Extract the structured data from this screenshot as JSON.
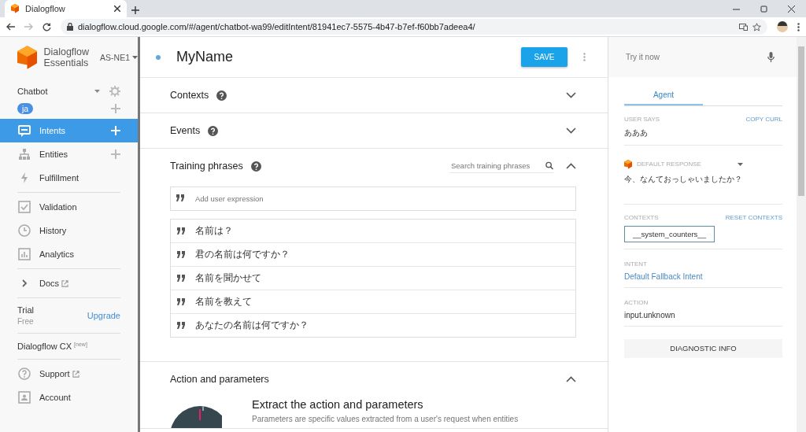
{
  "browser": {
    "tab_title": "Dialogflow",
    "url": "dialogflow.cloud.google.com/#/agent/chatbot-wa99/editIntent/81941ec7-5575-4b47-b7ef-f60bb7adeea4/"
  },
  "sidebar": {
    "brand_line1": "Dialogflow",
    "brand_line2": "Essentials",
    "region": "AS-NE1",
    "agent": "Chatbot",
    "language": "ja",
    "nav_groups": [
      [
        {
          "label": "Intents",
          "selected": true,
          "addable": true,
          "kind": "page"
        },
        {
          "label": "Entities",
          "selected": false,
          "addable": true,
          "kind": "page"
        },
        {
          "label": "Fulfillment",
          "selected": false,
          "addable": false,
          "kind": "page"
        }
      ],
      [
        {
          "label": "Validation",
          "selected": false,
          "addable": false,
          "kind": "page"
        },
        {
          "label": "History",
          "selected": false,
          "addable": false,
          "kind": "page"
        },
        {
          "label": "Analytics",
          "selected": false,
          "addable": false,
          "kind": "page"
        }
      ],
      [
        {
          "label": "Docs",
          "selected": false,
          "addable": false,
          "kind": "external"
        }
      ]
    ],
    "plan": {
      "name": "Trial",
      "tier": "Free",
      "upgrade": "Upgrade"
    },
    "cx": {
      "label": "Dialogflow CX",
      "badge": "[new]"
    },
    "bottom_nav": [
      {
        "label": "Support",
        "selected": false,
        "kind": "external"
      },
      {
        "label": "Account",
        "selected": false,
        "kind": "page"
      }
    ]
  },
  "intent": {
    "title": "MyName",
    "save": "SAVE"
  },
  "sections": [
    {
      "title": "Contexts",
      "help": true,
      "expanded": false
    },
    {
      "title": "Events",
      "help": true,
      "expanded": false
    },
    {
      "title": "Training phrases",
      "help": true,
      "expanded": true,
      "search_placeholder": "Search training phrases",
      "add_placeholder": "Add user expression",
      "phrases": [
        "名前は？",
        "君の名前は何ですか？",
        "名前を聞かせて",
        "名前を教えて",
        "あなたの名前は何ですか？"
      ]
    },
    {
      "title": "Action and parameters",
      "help": false,
      "expanded": true,
      "heading": "Extract the action and parameters",
      "text": "Parameters are specific values extracted from a user's request when entities"
    }
  ],
  "console": {
    "try_placeholder": "Try it now",
    "tabs": [
      {
        "label": "Agent",
        "selected": true
      }
    ],
    "user_says_label": "USER SAYS",
    "copy_curl": "COPY CURL",
    "user_says": "あああ",
    "response_label": "DEFAULT RESPONSE",
    "response": "今、なんておっしゃいましたか？",
    "contexts_label": "CONTEXTS",
    "reset_contexts": "RESET CONTEXTS",
    "context": "__system_counters__",
    "intent_label": "INTENT",
    "intent": "Default Fallback Intent",
    "action_label": "ACTION",
    "action": "input.unknown",
    "diagnostic": "DIAGNOSTIC INFO"
  }
}
